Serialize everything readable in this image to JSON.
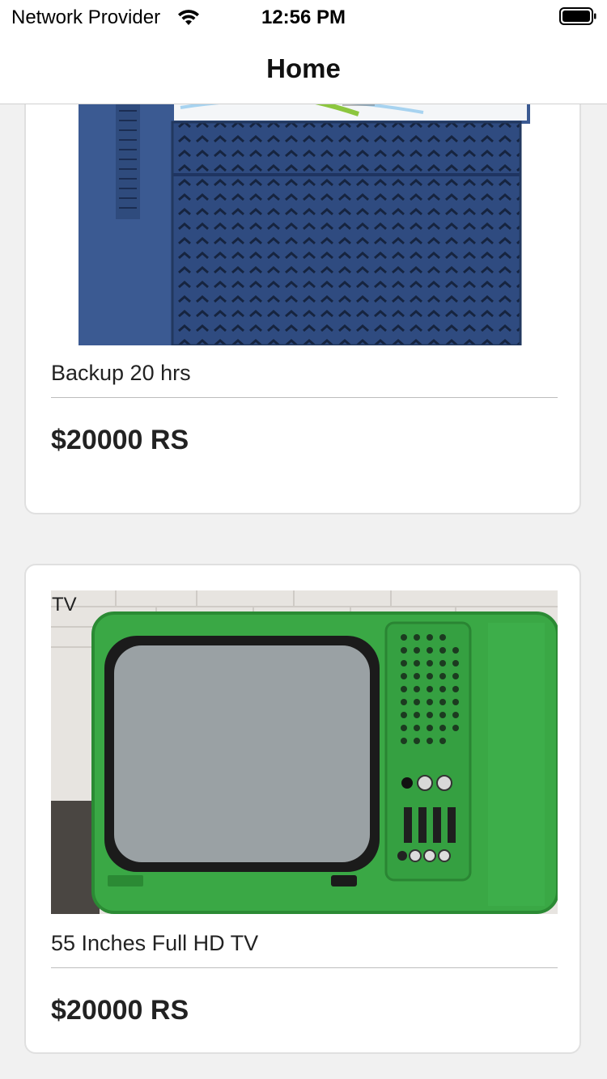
{
  "status_bar": {
    "carrier": "Network Provider",
    "time": "12:56 PM"
  },
  "nav": {
    "title": "Home"
  },
  "products": [
    {
      "category": "",
      "description": "Backup 20 hrs",
      "price": "$20000 RS",
      "image_icon": "inverter-image"
    },
    {
      "category": "TV",
      "description": "55 Inches Full HD TV",
      "price": "$20000 RS",
      "image_icon": "green-tv-image"
    }
  ],
  "colors": {
    "background": "#f1f1f1",
    "card": "#ffffff",
    "inverter_body": "#2e4a7e",
    "tv_body": "#3aa845"
  }
}
